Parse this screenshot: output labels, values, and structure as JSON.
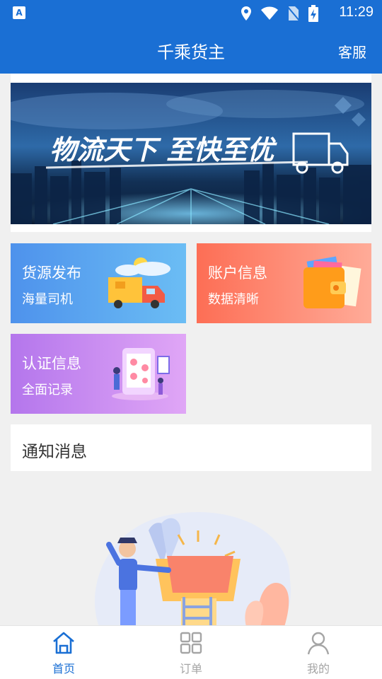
{
  "status_bar": {
    "time": "11:29",
    "app_badge": "A"
  },
  "header": {
    "title": "千乘货主",
    "service_label": "客服"
  },
  "banner": {
    "slogan": "物流天下 至快至优"
  },
  "cards": [
    {
      "title": "货源发布",
      "subtitle": "海量司机"
    },
    {
      "title": "账户信息",
      "subtitle": "数据清晰"
    },
    {
      "title": "认证信息",
      "subtitle": "全面记录"
    }
  ],
  "notice": {
    "title": "通知消息"
  },
  "tabbar": {
    "items": [
      {
        "label": "首页",
        "icon": "home-icon",
        "active": true
      },
      {
        "label": "订单",
        "icon": "grid-icon",
        "active": false
      },
      {
        "label": "我的",
        "icon": "user-icon",
        "active": false
      }
    ]
  },
  "colors": {
    "primary": "#1a6fd4",
    "card_goods": "#4e92ec",
    "card_account": "#fd6e55",
    "card_cert": "#b476ec",
    "tab_inactive": "#a5a5a5"
  }
}
